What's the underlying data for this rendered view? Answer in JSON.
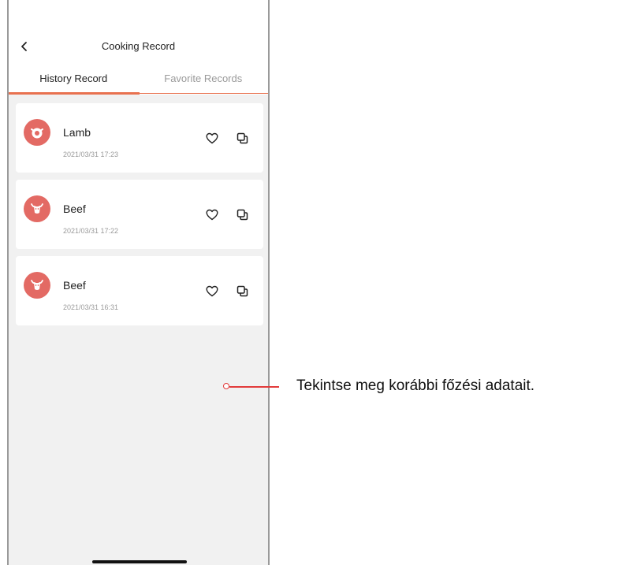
{
  "header": {
    "title": "Cooking Record"
  },
  "tabs": [
    {
      "label": "History Record",
      "active": true
    },
    {
      "label": "Favorite Records",
      "active": false
    }
  ],
  "records": [
    {
      "name": "Lamb",
      "date": "2021/03/31 17:23",
      "icon": "lamb-icon"
    },
    {
      "name": "Beef",
      "date": "2021/03/31 17:22",
      "icon": "beef-icon"
    },
    {
      "name": "Beef",
      "date": "2021/03/31 16:31",
      "icon": "beef-icon"
    }
  ],
  "annotation": {
    "text": "Tekintse meg korábbi főzési adatait."
  },
  "colors": {
    "accent": "#e8714f",
    "avatar": "#e36a64",
    "background": "#f1f1f1",
    "callout": "#e23b3b"
  }
}
